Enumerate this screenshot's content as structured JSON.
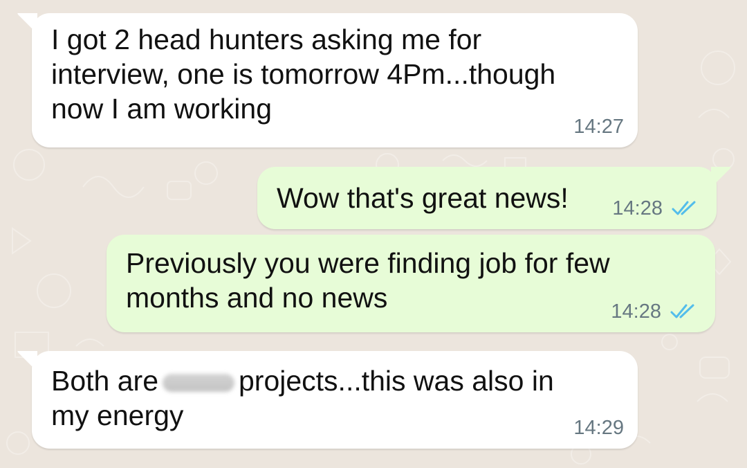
{
  "theme": {
    "incoming_bubble": "#ffffff",
    "outgoing_bubble": "#e7fcd7",
    "wallpaper": "#ece5dd",
    "timestamp": "#667781",
    "read_tick": "#53bdeb"
  },
  "messages": [
    {
      "direction": "incoming",
      "text": "I got 2 head hunters asking me for\ninterview,  one is tomorrow 4Pm...though\nnow I am working",
      "time": "14:27"
    },
    {
      "direction": "outgoing",
      "text": "Wow that's great news!",
      "time": "14:28",
      "status_icon": "double-check-read-icon"
    },
    {
      "direction": "outgoing",
      "text": "Previously you were finding job for few\nmonths and no news",
      "time": "14:28",
      "status_icon": "double-check-read-icon"
    },
    {
      "direction": "incoming",
      "text_before": "Both are",
      "text_after": "projects...this was also in\nmy energy",
      "time": "14:29",
      "redacted": true
    }
  ]
}
